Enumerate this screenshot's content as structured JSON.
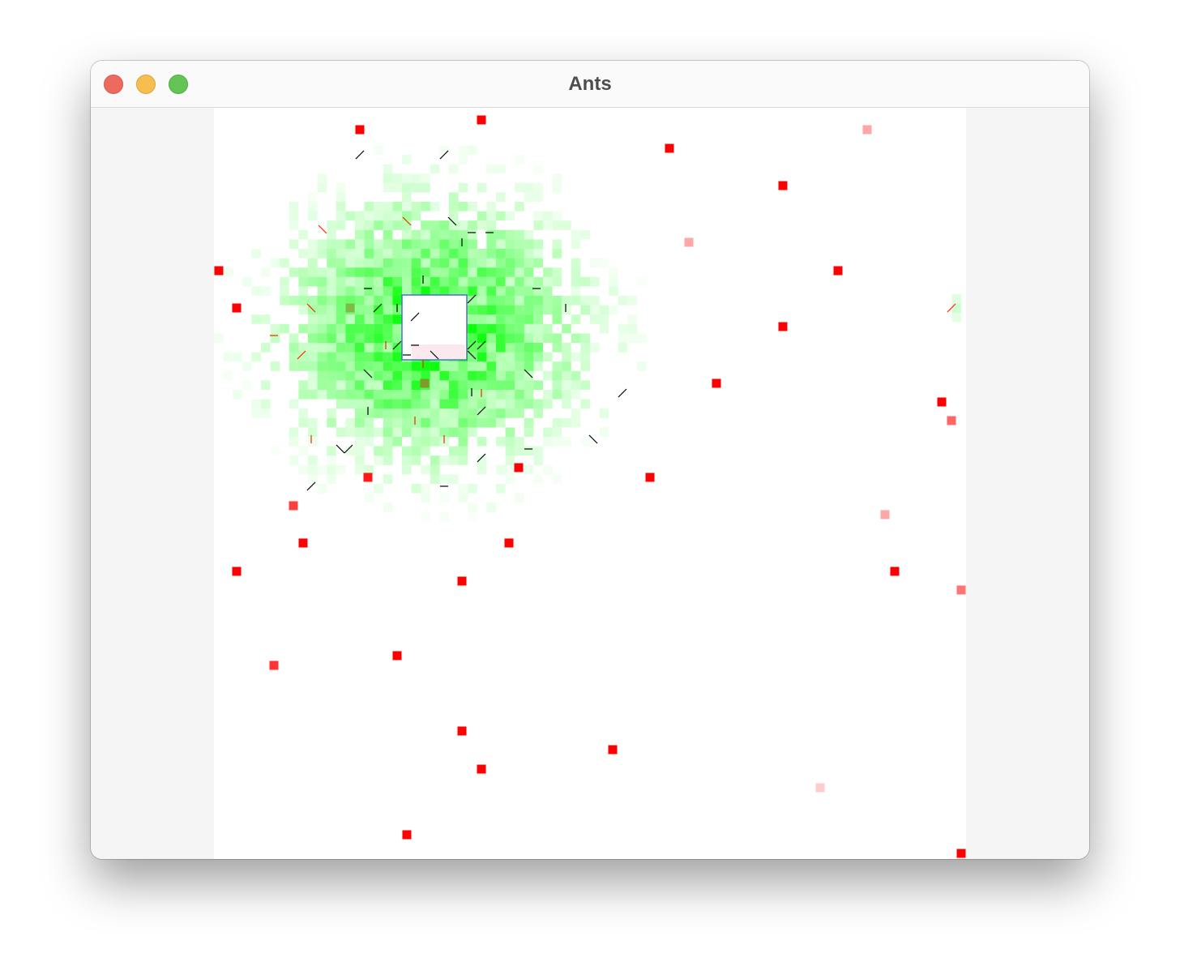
{
  "window": {
    "title": "Ants"
  },
  "simulation": {
    "colors": {
      "food": "#ff0000",
      "nest_border": "#4a6fd6",
      "pheromone": "#00ff00",
      "ant": "#000000",
      "ant_carrying": "#ff2200",
      "background": "#ffffff"
    }
  }
}
